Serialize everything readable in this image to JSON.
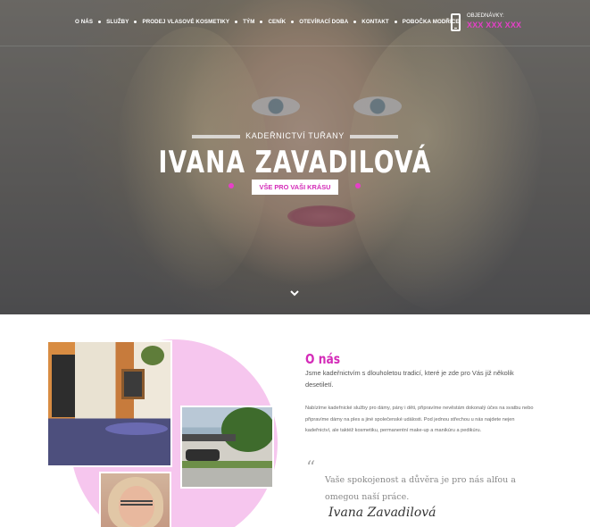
{
  "nav": {
    "items": [
      {
        "label": "O NÁS"
      },
      {
        "label": "SLUŽBY"
      },
      {
        "label": "PRODEJ VLASOVÉ KOSMETIKY"
      },
      {
        "label": "TÝM"
      },
      {
        "label": "CENÍK"
      },
      {
        "label": "OTEVÍRACÍ DOBA"
      },
      {
        "label": "KONTAKT"
      },
      {
        "label": "POBOČKA MODŘICE"
      }
    ],
    "order_label": "OBJEDNÁVKY:",
    "order_phone": "XXX XXX XXX",
    "icon": "phone-icon"
  },
  "hero": {
    "subtitle": "KADEŘNICTVÍ TUŘANY",
    "title": "IVANA ZAVADILOVÁ",
    "button_label": "VŠE PRO VAŠI KRÁSU",
    "scroll_icon": "chevron-down-icon"
  },
  "about": {
    "title": "O nás",
    "intro": "Jsme kadeřnictvím s dlouholetou tradicí, které je zde pro Vás již několik desetiletí.",
    "body": "Nabízíme kadeřnické služby pro dámy, pány i děti, připravíme nevěstám dokonalý účes na svatbu nebo připravíme dámy na ples a jiné společenské události. Pod jednou střechou u nás najdete nejen kadeřnictví, ale taktéž kosmetiku, permanentní make-up a manikúru a pedikúru.",
    "quote": "Vaše spokojenost a důvěra je pro nás alfou a omegou naší práce.",
    "signature": "Ivana Zavadilová"
  },
  "colors": {
    "accent": "#d42bb8",
    "accent_light": "#f6c6ee",
    "phone": "#e63fc8"
  }
}
